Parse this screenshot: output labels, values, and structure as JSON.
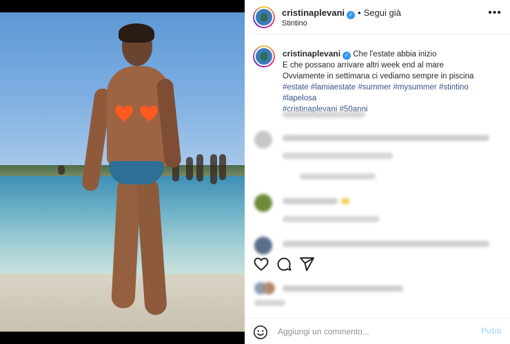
{
  "post": {
    "author": "cristinaplevani",
    "follow_label": "Segui già",
    "location": "Stintino",
    "more_label": "•••"
  },
  "caption": {
    "author": "cristinaplevani",
    "line1": "Che l'estate abbia inizio",
    "line2": "E che possano arrivare altri week end al mare",
    "line3": "Ovviamente in settimana ci vediamo sempre in piscina",
    "hashtags_line1": "#estate #lamiaestate #summer #mysummer #stintino #lapelosa",
    "hashtags_line2": "#cristinaplevani #50anni"
  },
  "comment_box": {
    "placeholder": "Aggiungi un commento...",
    "post_label": "Pubb"
  },
  "icons": {
    "verified": "verified-badge-icon",
    "like": "heart-icon",
    "comment": "comment-icon",
    "share": "paper-plane-icon",
    "emoji": "emoji-icon"
  },
  "colors": {
    "accent": "#3897f0",
    "hashtag": "#385185",
    "censor_heart": "#ff5a1f"
  }
}
